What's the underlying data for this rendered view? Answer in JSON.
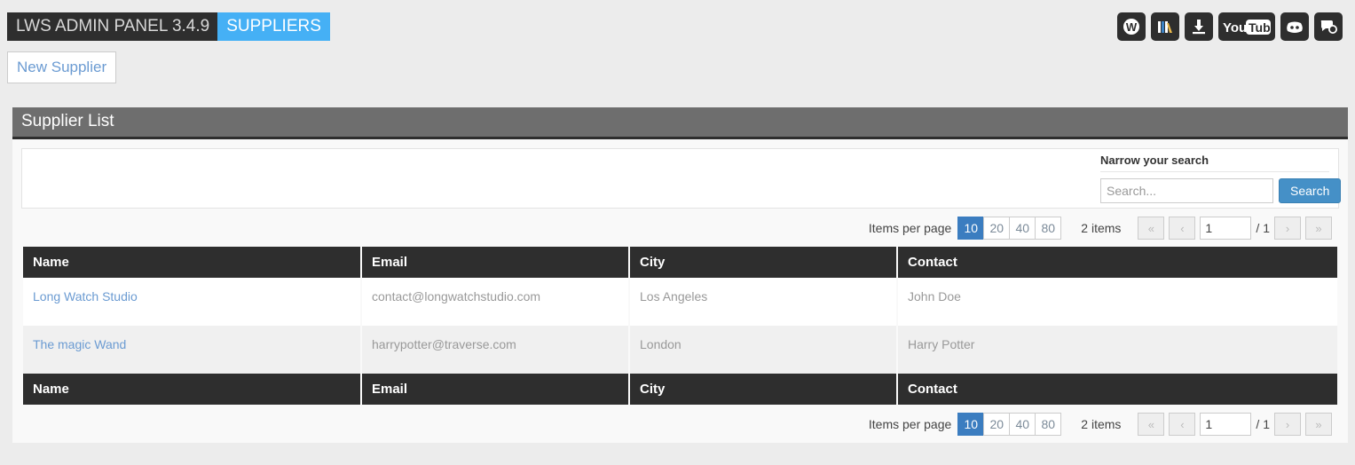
{
  "header": {
    "app_title": "LWS ADMIN PANEL 3.4.9",
    "section": "SUPPLIERS",
    "icons": [
      {
        "name": "wiki-icon",
        "label": "W"
      },
      {
        "name": "library-icon",
        "label": "Library"
      },
      {
        "name": "download-icon",
        "label": "Download"
      },
      {
        "name": "youtube-icon",
        "label": "YouTube"
      },
      {
        "name": "discord-icon",
        "label": "Discord"
      },
      {
        "name": "chat-icon",
        "label": "Chat"
      }
    ]
  },
  "actions": {
    "new_supplier": "New Supplier"
  },
  "panel": {
    "title": "Supplier List"
  },
  "search": {
    "title": "Narrow your search",
    "placeholder": "Search...",
    "value": "",
    "button": "Search"
  },
  "pagination": {
    "items_per_page_label": "Items per page",
    "options": [
      "10",
      "20",
      "40",
      "80"
    ],
    "selected": "10",
    "items_count": "2 items",
    "first": "«",
    "prev": "‹",
    "next": "›",
    "last": "»",
    "page_value": "1",
    "page_total": "/ 1"
  },
  "table": {
    "columns": [
      "Name",
      "Email",
      "City",
      "Contact"
    ],
    "rows": [
      {
        "name": "Long Watch Studio",
        "email": "contact@longwatchstudio.com",
        "city": "Los Angeles",
        "contact": "John Doe"
      },
      {
        "name": "The magic Wand",
        "email": "harrypotter@traverse.com",
        "city": "London",
        "contact": "Harry Potter"
      }
    ]
  },
  "colors": {
    "accent_blue": "#45b0f5",
    "button_blue": "#3b7dc0",
    "dark": "#2e2e2e",
    "panel_header": "#6e6e6e",
    "link": "#6b9bd2"
  }
}
